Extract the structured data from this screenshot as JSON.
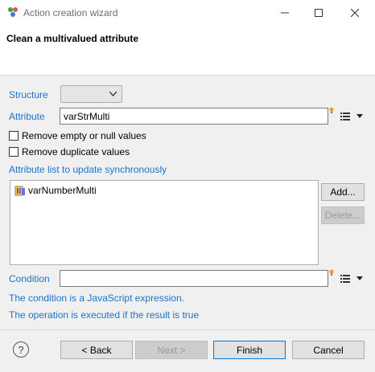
{
  "window": {
    "title": "Action creation wizard",
    "minimize_label": "—",
    "maximize_label": "☐",
    "close_label": "✕"
  },
  "header": {
    "title": "Clean a multivalued attribute"
  },
  "form": {
    "structure_label": "Structure",
    "structure_value": "",
    "attribute_label": "Attribute",
    "attribute_value": "varStrMulti",
    "remove_empty_label": "Remove empty or null values",
    "remove_duplicate_label": "Remove duplicate values",
    "sync_list_label": "Attribute list to update synchronously",
    "sync_list_items": [
      "varNumberMulti"
    ],
    "add_button": "Add...",
    "delete_button": "Delete...",
    "condition_label": "Condition",
    "condition_value": "",
    "info_line_1": "The condition is a JavaScript expression.",
    "info_line_2": "The operation is executed if the result is true"
  },
  "footer": {
    "help_label": "?",
    "back_button": "< Back",
    "next_button": "Next >",
    "finish_button": "Finish",
    "cancel_button": "Cancel"
  },
  "colors": {
    "accent": "#1a74c6",
    "bulb": "#e8a33a"
  }
}
